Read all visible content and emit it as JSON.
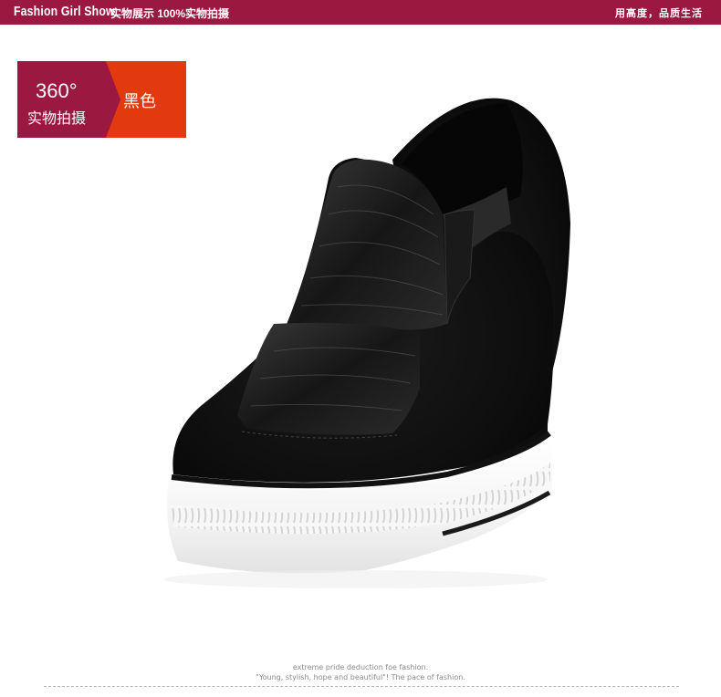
{
  "header": {
    "brand": "Fashion Girl Show",
    "subtitle": "实物展示 100%实物拍摄",
    "slogan": "用高度，品质生活"
  },
  "badge": {
    "degrees": "360°",
    "caption": "实物拍摄",
    "color_name": "黑色",
    "colors": {
      "left": "#9b1840",
      "right": "#e3390f"
    }
  },
  "product": {
    "image": "black-suede-wedge-slip-on-sneaker"
  },
  "footer": {
    "line1": "extreme pride deduction foe fashion.",
    "line2": "\"Young, stylish, hope and beautiful\"! The pace of fashion."
  }
}
